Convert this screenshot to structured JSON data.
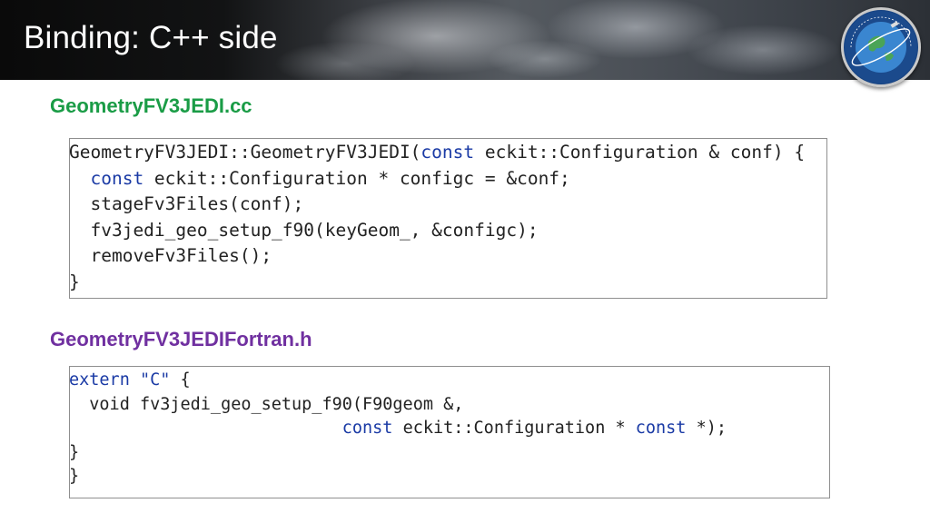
{
  "slide": {
    "title": "Binding: C++ side"
  },
  "logo": {
    "icon": "jcsda-logo",
    "text": "JOINT CENTER FOR SATELLITE DATA ASSIMILATION"
  },
  "section_cc": {
    "filename": "GeometryFV3JEDI.cc",
    "color": "#1a9c46",
    "lines": [
      [
        {
          "t": "GeometryFV3JEDI::GeometryFV3JEDI(",
          "k": "plain"
        },
        {
          "t": "const",
          "k": "kw"
        },
        {
          "t": " eckit::Configuration & conf) {",
          "k": "plain"
        }
      ],
      [
        {
          "t": "  ",
          "k": "plain"
        },
        {
          "t": "const",
          "k": "kw"
        },
        {
          "t": " eckit::Configuration * configc = &conf;",
          "k": "plain"
        }
      ],
      [
        {
          "t": "  stageFv3Files(conf);",
          "k": "plain"
        }
      ],
      [
        {
          "t": "  fv3jedi_geo_setup_f90(keyGeom_, &configc);",
          "k": "plain"
        }
      ],
      [
        {
          "t": "  removeFv3Files();",
          "k": "plain"
        }
      ],
      [
        {
          "t": "}",
          "k": "plain"
        }
      ]
    ]
  },
  "section_h": {
    "filename": "GeometryFV3JEDIFortran.h",
    "color": "#7030a0",
    "lines": [
      [
        {
          "t": "extern",
          "k": "kw"
        },
        {
          "t": " ",
          "k": "plain"
        },
        {
          "t": "\"C\"",
          "k": "str"
        },
        {
          "t": " {",
          "k": "plain"
        }
      ],
      [
        {
          "t": "  void fv3jedi_geo_setup_f90(F90geom &,",
          "k": "plain"
        }
      ],
      [
        {
          "t": "                           ",
          "k": "plain"
        },
        {
          "t": "const",
          "k": "kw"
        },
        {
          "t": " eckit::Configuration * ",
          "k": "plain"
        },
        {
          "t": "const",
          "k": "kw"
        },
        {
          "t": " *);",
          "k": "plain"
        }
      ],
      [
        {
          "t": "}",
          "k": "plain"
        }
      ],
      [
        {
          "t": "}",
          "k": "plain"
        }
      ]
    ]
  },
  "colors": {
    "keyword": "#1a3aa5",
    "text": "#222222"
  }
}
